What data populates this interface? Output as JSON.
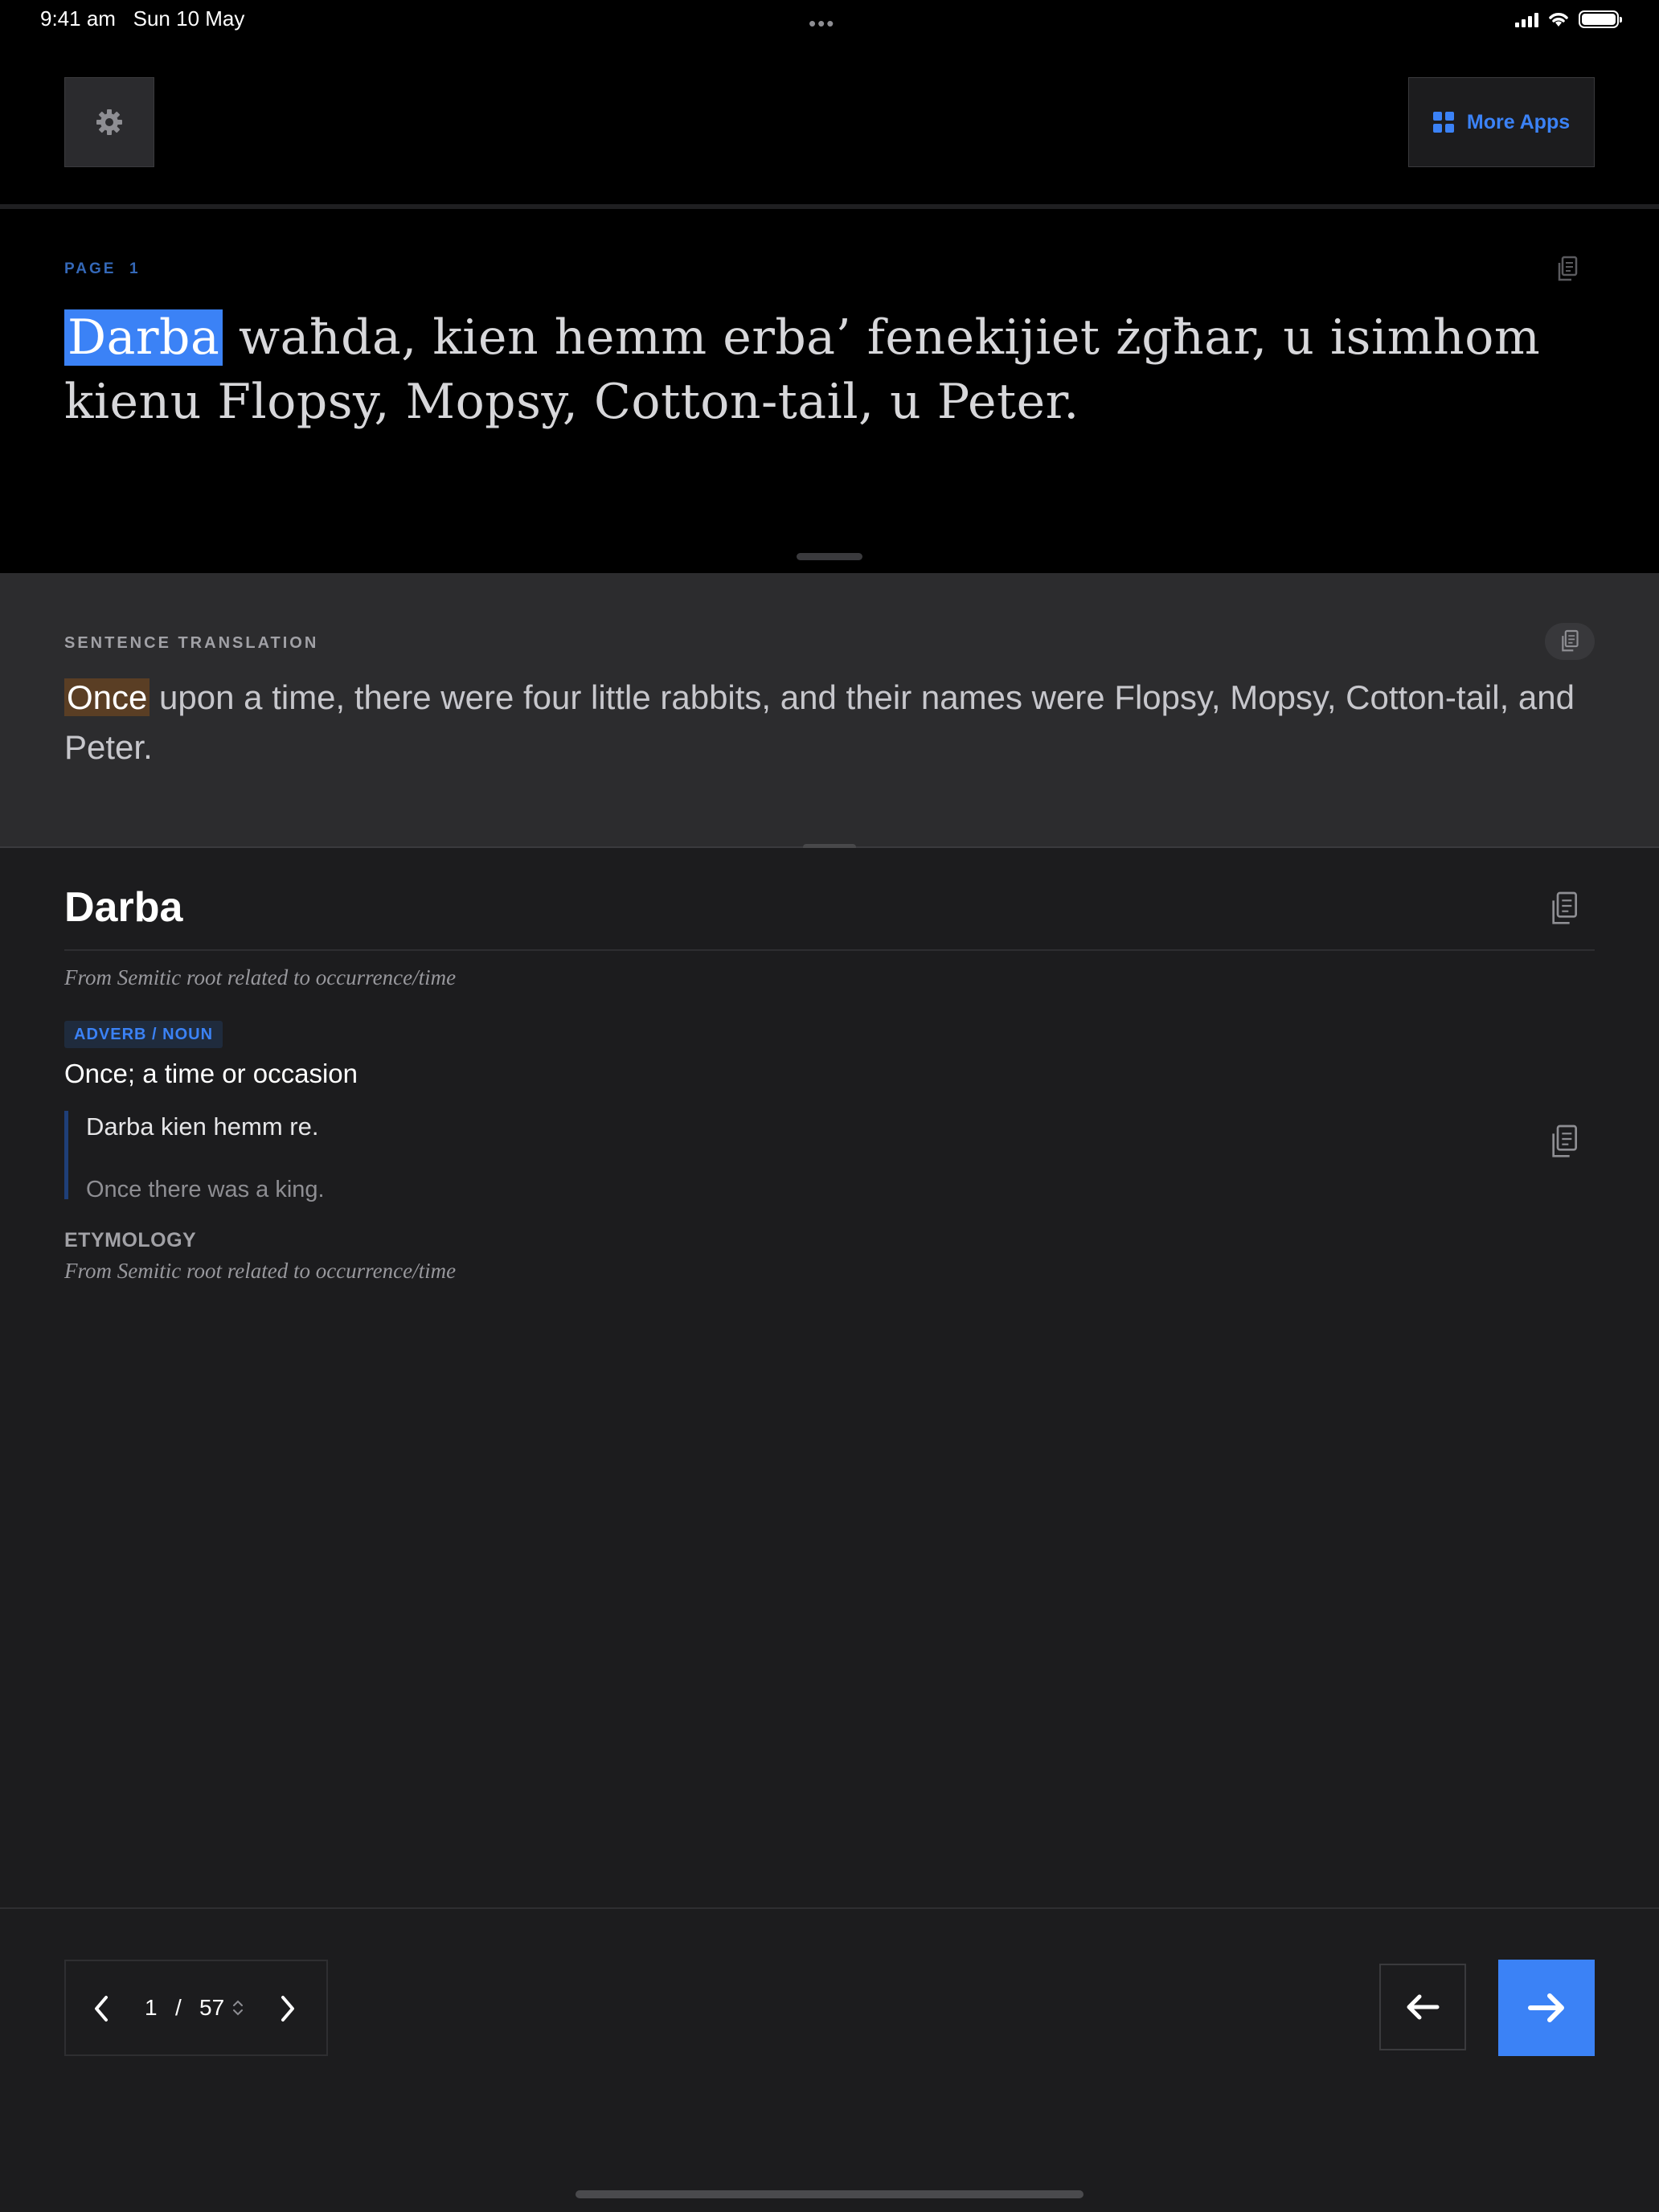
{
  "status_bar": {
    "time": "9:41 am",
    "date": "Sun 10 May",
    "multitask_dots": "•••",
    "icons": [
      "cellular-signal-icon",
      "wifi-icon",
      "battery-icon"
    ]
  },
  "header": {
    "settings_icon": "gear-icon",
    "more_apps_label": "More Apps",
    "more_apps_icon": "grid-icon"
  },
  "source": {
    "page_label": "PAGE",
    "page_number": "1",
    "highlighted_word": "Darba",
    "rest_text": " waħda, kien hemm erba’ fenekijiet żgħar, u isimhom kienu Flopsy, Mopsy, Cotton-tail, u Peter.",
    "copy_icon": "copy-icon"
  },
  "translation": {
    "label": "SENTENCE TRANSLATION",
    "highlighted_word": "Once",
    "rest_text": " upon a time, there were four little rabbits, and their names were Flopsy, Mopsy, Cotton-tail, and Peter.",
    "copy_icon": "copy-icon"
  },
  "entry": {
    "word": "Darba",
    "origin": "From Semitic root related to occurrence/time",
    "part_of_speech": "ADVERB / NOUN",
    "meaning": "Once; a time or occasion",
    "example_maltese": "Darba kien hemm re.",
    "example_english": "Once there was a king.",
    "etymology_label": "ETYMOLOGY",
    "etymology_text": "From Semitic root related to occurrence/time"
  },
  "pagination": {
    "current": "1",
    "separator": "/",
    "total": "57"
  },
  "colors": {
    "accent": "#3b82f6",
    "translation_highlight": "#5a3e24",
    "background_top": "#000000",
    "background_panel": "#2c2c2e",
    "background_main": "#1c1c1e"
  }
}
